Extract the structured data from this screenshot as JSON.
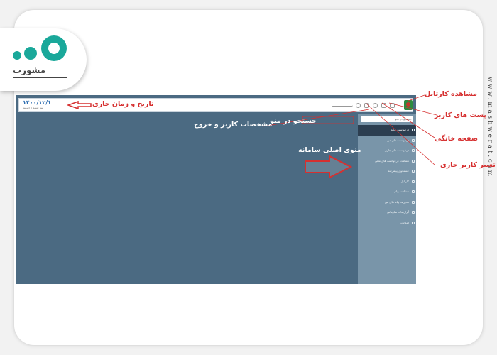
{
  "brand": {
    "logo_text": "مشورت",
    "watermark": "www.mashwerat.com",
    "accent": "#1aa89a"
  },
  "app": {
    "datetime": {
      "date": "۱۴۰۰/۱۲/۱",
      "weekday": "سه شنبه ۱ اسفند"
    },
    "search_placeholder": "جستجو در منو",
    "menu": [
      {
        "label": "درخواست جدید",
        "icon": "document-icon",
        "active": true
      },
      {
        "label": "درخواست های من",
        "icon": "list-icon"
      },
      {
        "label": "درخواست های جاری",
        "icon": "clock-icon"
      },
      {
        "label": "مشاهده درخواست های مالی",
        "icon": "money-icon"
      },
      {
        "label": "جستجوی پیشرفته",
        "icon": "search-icon"
      },
      {
        "label": "کارتابل",
        "icon": "inbox-icon"
      },
      {
        "label": "مشاهده پیام",
        "icon": "mail-icon"
      },
      {
        "label": "مدیریت پیام های من",
        "icon": "message-icon"
      },
      {
        "label": "گزارشات سازمانی",
        "icon": "report-icon"
      },
      {
        "label": "امکانات",
        "icon": "tools-icon"
      }
    ],
    "colors": {
      "content_bg": "#4b6a82",
      "sidebar_bg": "#7995a9",
      "active_item_bg": "#2c3e50"
    }
  },
  "annotations": {
    "datetime": "تاریخ و زمان جاری",
    "cartable": "مشاهده کارتابل",
    "posts": "پست های کاربر",
    "home": "صفحه خانگی",
    "change_user": "تغییر کاربر جاری",
    "search": "جستجو در منو",
    "user_info": "مشخصات کاربر و خروج",
    "main_menu": "منوی اصلی سامانه",
    "color": "#d63030"
  }
}
